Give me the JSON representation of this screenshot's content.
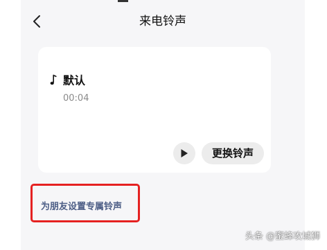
{
  "header": {
    "title": "来电铃声",
    "back_icon": "chevron-left-icon"
  },
  "ringtone_card": {
    "icon": "music-note-icon",
    "name": "默认",
    "duration": "00:04",
    "play_icon": "play-icon",
    "change_label": "更换铃声"
  },
  "friend_ringtone": {
    "label": "为朋友设置专属铃声"
  },
  "watermark": {
    "text": "头条 @蜜蜂攻城狮"
  },
  "colors": {
    "screen_background": "#f6f6f8",
    "card_background": "#ffffff",
    "button_background": "#ececec",
    "link_text": "#4d5e86",
    "highlight_border": "#e52121"
  }
}
